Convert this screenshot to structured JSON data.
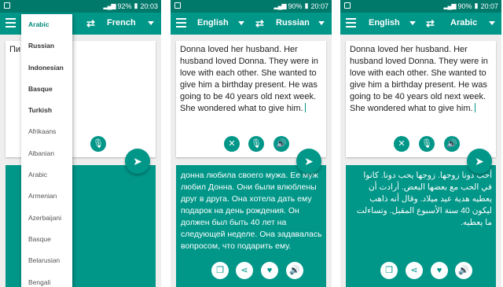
{
  "screens": [
    {
      "status": {
        "battery": "92%",
        "time": "20:03"
      },
      "toolbar": {
        "source_lang": "",
        "target_lang": "French"
      },
      "input": {
        "text": "Пи…"
      },
      "output": {
        "text": ""
      },
      "dropdown": {
        "items": [
          "Arabic",
          "Russian",
          "Indonesian",
          "Basque",
          "Turkish",
          "Afrikaans",
          "Albanian",
          "Arabic",
          "Armenian",
          "Azerbaijani",
          "Basque",
          "Belarusian",
          "Bengali"
        ],
        "selected": "Arabic"
      }
    },
    {
      "status": {
        "battery": "90%",
        "time": "20:07"
      },
      "toolbar": {
        "source_lang": "English",
        "target_lang": "Russian"
      },
      "input": {
        "text": "Donna loved her husband. Her husband loved Donna. They were in love with each other. She wanted to give him a birthday present. He was going to be 40 years old next week. She wondered what to give him."
      },
      "output": {
        "text": "донна любила своего мужа. Ее муж любил Донна. Они были влюблены друг в друга. Она хотела дать ему подарок на день рождения. Он должен был быть 40 лет на следующей неделе. Она задавалась вопросом, что подарить ему."
      }
    },
    {
      "status": {
        "battery": "90%",
        "time": "20:07"
      },
      "toolbar": {
        "source_lang": "English",
        "target_lang": "Arabic"
      },
      "input": {
        "text": "Donna loved her husband. Her husband loved Donna. They were in love with each other. She wanted to give him a birthday present. He was going to be 40 years old next week. She wondered what to give him."
      },
      "output": {
        "text": "أحب دونا زوجها. زوجها يحب دونا. كانوا في الحب مع بعضها البعض. أرادت أن يعطيه هدية عيد ميلاد. وقال أنه ذاهب ليكون 40 سنة الأسبوع المقبل. وتساءلت ما يعطيه."
      }
    }
  ],
  "icons": {
    "menu": "menu-icon",
    "swap": "swap-icon",
    "clear": "close-icon",
    "mic": "microphone-icon",
    "speaker": "speaker-icon",
    "send": "send-icon",
    "copy": "copy-icon",
    "share": "share-icon",
    "favorite": "heart-icon"
  },
  "colors": {
    "primary": "#009688",
    "status_bar": "#00796b",
    "background": "#eeeeee",
    "selected_item": "#00897b"
  }
}
